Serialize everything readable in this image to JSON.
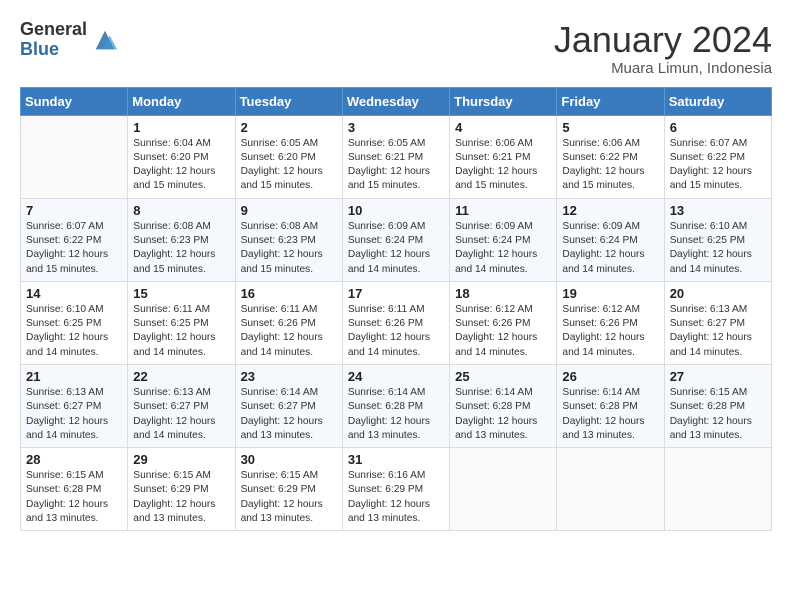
{
  "header": {
    "logo_general": "General",
    "logo_blue": "Blue",
    "month_title": "January 2024",
    "location": "Muara Limun, Indonesia"
  },
  "days_of_week": [
    "Sunday",
    "Monday",
    "Tuesday",
    "Wednesday",
    "Thursday",
    "Friday",
    "Saturday"
  ],
  "weeks": [
    [
      {
        "day": "",
        "info": ""
      },
      {
        "day": "1",
        "info": "Sunrise: 6:04 AM\nSunset: 6:20 PM\nDaylight: 12 hours\nand 15 minutes."
      },
      {
        "day": "2",
        "info": "Sunrise: 6:05 AM\nSunset: 6:20 PM\nDaylight: 12 hours\nand 15 minutes."
      },
      {
        "day": "3",
        "info": "Sunrise: 6:05 AM\nSunset: 6:21 PM\nDaylight: 12 hours\nand 15 minutes."
      },
      {
        "day": "4",
        "info": "Sunrise: 6:06 AM\nSunset: 6:21 PM\nDaylight: 12 hours\nand 15 minutes."
      },
      {
        "day": "5",
        "info": "Sunrise: 6:06 AM\nSunset: 6:22 PM\nDaylight: 12 hours\nand 15 minutes."
      },
      {
        "day": "6",
        "info": "Sunrise: 6:07 AM\nSunset: 6:22 PM\nDaylight: 12 hours\nand 15 minutes."
      }
    ],
    [
      {
        "day": "7",
        "info": "Sunrise: 6:07 AM\nSunset: 6:22 PM\nDaylight: 12 hours\nand 15 minutes."
      },
      {
        "day": "8",
        "info": "Sunrise: 6:08 AM\nSunset: 6:23 PM\nDaylight: 12 hours\nand 15 minutes."
      },
      {
        "day": "9",
        "info": "Sunrise: 6:08 AM\nSunset: 6:23 PM\nDaylight: 12 hours\nand 15 minutes."
      },
      {
        "day": "10",
        "info": "Sunrise: 6:09 AM\nSunset: 6:24 PM\nDaylight: 12 hours\nand 14 minutes."
      },
      {
        "day": "11",
        "info": "Sunrise: 6:09 AM\nSunset: 6:24 PM\nDaylight: 12 hours\nand 14 minutes."
      },
      {
        "day": "12",
        "info": "Sunrise: 6:09 AM\nSunset: 6:24 PM\nDaylight: 12 hours\nand 14 minutes."
      },
      {
        "day": "13",
        "info": "Sunrise: 6:10 AM\nSunset: 6:25 PM\nDaylight: 12 hours\nand 14 minutes."
      }
    ],
    [
      {
        "day": "14",
        "info": "Sunrise: 6:10 AM\nSunset: 6:25 PM\nDaylight: 12 hours\nand 14 minutes."
      },
      {
        "day": "15",
        "info": "Sunrise: 6:11 AM\nSunset: 6:25 PM\nDaylight: 12 hours\nand 14 minutes."
      },
      {
        "day": "16",
        "info": "Sunrise: 6:11 AM\nSunset: 6:26 PM\nDaylight: 12 hours\nand 14 minutes."
      },
      {
        "day": "17",
        "info": "Sunrise: 6:11 AM\nSunset: 6:26 PM\nDaylight: 12 hours\nand 14 minutes."
      },
      {
        "day": "18",
        "info": "Sunrise: 6:12 AM\nSunset: 6:26 PM\nDaylight: 12 hours\nand 14 minutes."
      },
      {
        "day": "19",
        "info": "Sunrise: 6:12 AM\nSunset: 6:26 PM\nDaylight: 12 hours\nand 14 minutes."
      },
      {
        "day": "20",
        "info": "Sunrise: 6:13 AM\nSunset: 6:27 PM\nDaylight: 12 hours\nand 14 minutes."
      }
    ],
    [
      {
        "day": "21",
        "info": "Sunrise: 6:13 AM\nSunset: 6:27 PM\nDaylight: 12 hours\nand 14 minutes."
      },
      {
        "day": "22",
        "info": "Sunrise: 6:13 AM\nSunset: 6:27 PM\nDaylight: 12 hours\nand 14 minutes."
      },
      {
        "day": "23",
        "info": "Sunrise: 6:14 AM\nSunset: 6:27 PM\nDaylight: 12 hours\nand 13 minutes."
      },
      {
        "day": "24",
        "info": "Sunrise: 6:14 AM\nSunset: 6:28 PM\nDaylight: 12 hours\nand 13 minutes."
      },
      {
        "day": "25",
        "info": "Sunrise: 6:14 AM\nSunset: 6:28 PM\nDaylight: 12 hours\nand 13 minutes."
      },
      {
        "day": "26",
        "info": "Sunrise: 6:14 AM\nSunset: 6:28 PM\nDaylight: 12 hours\nand 13 minutes."
      },
      {
        "day": "27",
        "info": "Sunrise: 6:15 AM\nSunset: 6:28 PM\nDaylight: 12 hours\nand 13 minutes."
      }
    ],
    [
      {
        "day": "28",
        "info": "Sunrise: 6:15 AM\nSunset: 6:28 PM\nDaylight: 12 hours\nand 13 minutes."
      },
      {
        "day": "29",
        "info": "Sunrise: 6:15 AM\nSunset: 6:29 PM\nDaylight: 12 hours\nand 13 minutes."
      },
      {
        "day": "30",
        "info": "Sunrise: 6:15 AM\nSunset: 6:29 PM\nDaylight: 12 hours\nand 13 minutes."
      },
      {
        "day": "31",
        "info": "Sunrise: 6:16 AM\nSunset: 6:29 PM\nDaylight: 12 hours\nand 13 minutes."
      },
      {
        "day": "",
        "info": ""
      },
      {
        "day": "",
        "info": ""
      },
      {
        "day": "",
        "info": ""
      }
    ]
  ]
}
